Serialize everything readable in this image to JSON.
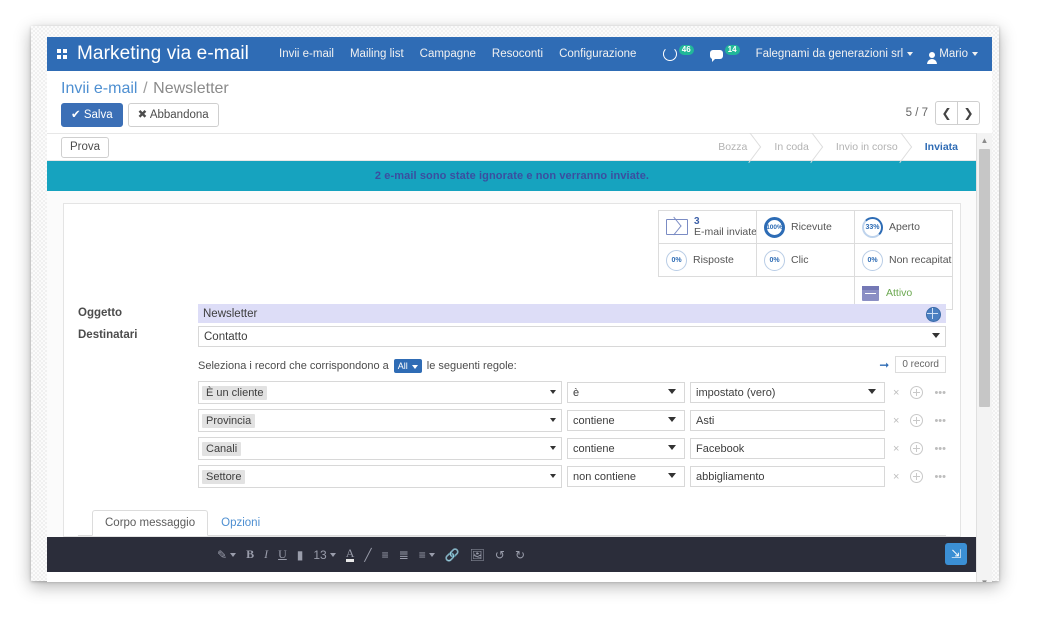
{
  "navbar": {
    "apps_icon": "apps-grid-icon",
    "brand": "Marketing via e-mail",
    "links": [
      "Invii e-mail",
      "Mailing list",
      "Campagne",
      "Resoconti",
      "Configurazione"
    ],
    "sync_icon": "sync-icon",
    "sync_badge": "46",
    "chat_icon": "chat-icon",
    "chat_badge": "14",
    "company": "Falegnami da generazioni srl",
    "user": "Mario",
    "brand_color": "#2f6cb5",
    "badge_color": "#21b799"
  },
  "breadcrumb": {
    "root": "Invii e-mail",
    "separator": "/",
    "current": "Newsletter"
  },
  "toolbar": {
    "save_label": "Salva",
    "discard_label": "Abbandona",
    "save_icon": "check-icon",
    "discard_icon": "x-icon",
    "pager_text": "5 / 7",
    "prev_icon": "chevron-left-icon",
    "next_icon": "chevron-right-icon"
  },
  "statusbar": {
    "test_button": "Prova",
    "stages": [
      {
        "label": "Bozza",
        "active": false
      },
      {
        "label": "In coda",
        "active": false
      },
      {
        "label": "Invio in corso",
        "active": false
      },
      {
        "label": "Inviata",
        "active": true
      }
    ]
  },
  "alert": {
    "text": "2 e-mail sono state ignorate e non verranno inviate.",
    "bg": "#16a3bf",
    "fg": "#3b4ea0"
  },
  "stats": {
    "sent": {
      "value": "3",
      "label": "E-mail inviate",
      "icon": "envelope-icon"
    },
    "received": {
      "value": "100%",
      "label": "Ricevute",
      "icon": "donut-icon"
    },
    "opened": {
      "value": "33%",
      "label": "Aperto",
      "icon": "donut-icon"
    },
    "replied": {
      "value": "0%",
      "label": "Risposte",
      "icon": "donut-icon"
    },
    "clicked": {
      "value": "0%",
      "label": "Clic",
      "icon": "donut-icon"
    },
    "bounced": {
      "value": "0%",
      "label": "Non recapitate",
      "icon": "donut-icon"
    },
    "active": {
      "label": "Attivo",
      "icon": "archive-icon"
    }
  },
  "form": {
    "subject_label": "Oggetto",
    "subject_value": "Newsletter",
    "translate_icon": "globe-icon",
    "recipients_label": "Destinatari",
    "recipients_value": "Contatto",
    "domain_prefix": "Seleziona i record che corrispondono a",
    "domain_all": "All",
    "domain_suffix": "le seguenti regole:",
    "record_count": "0 record",
    "record_arrow_icon": "arrow-right-icon",
    "rules": [
      {
        "field": "È un cliente",
        "operator": "è",
        "value": "impostato (vero)",
        "value_is_select": true
      },
      {
        "field": "Provincia",
        "operator": "contiene",
        "value": "Asti",
        "value_is_select": false
      },
      {
        "field": "Canali",
        "operator": "contiene",
        "value": "Facebook",
        "value_is_select": false
      },
      {
        "field": "Settore",
        "operator": "non contiene",
        "value": "abbigliamento",
        "value_is_select": false
      }
    ],
    "rule_actions": {
      "remove_icon": "x-icon",
      "add_icon": "plus-circle-icon",
      "branch_icon": "ellipsis-icon",
      "branch_label": "•••",
      "remove_label": "×"
    }
  },
  "notebook": {
    "tabs": [
      {
        "label": "Corpo messaggio",
        "active": true
      },
      {
        "label": "Opzioni",
        "active": false
      }
    ]
  },
  "editor": {
    "style_label": "style-dropdown-icon",
    "bold": "B",
    "italic": "I",
    "underline": "U",
    "strike": "strikethrough-icon",
    "font_size": "13",
    "text_color": "A",
    "highlight": "highlighter-icon",
    "unordered_list": "bullet-list-icon",
    "ordered_list": "numbered-list-icon",
    "align": "align-icon",
    "link": "link-icon",
    "image": "image-icon",
    "undo": "undo-icon",
    "redo": "redo-icon",
    "expand": "expand-icon",
    "expand_color": "#3b8fd4"
  },
  "scrollbar": {
    "up_icon": "scroll-up-icon",
    "down_icon": "scroll-down-icon"
  }
}
